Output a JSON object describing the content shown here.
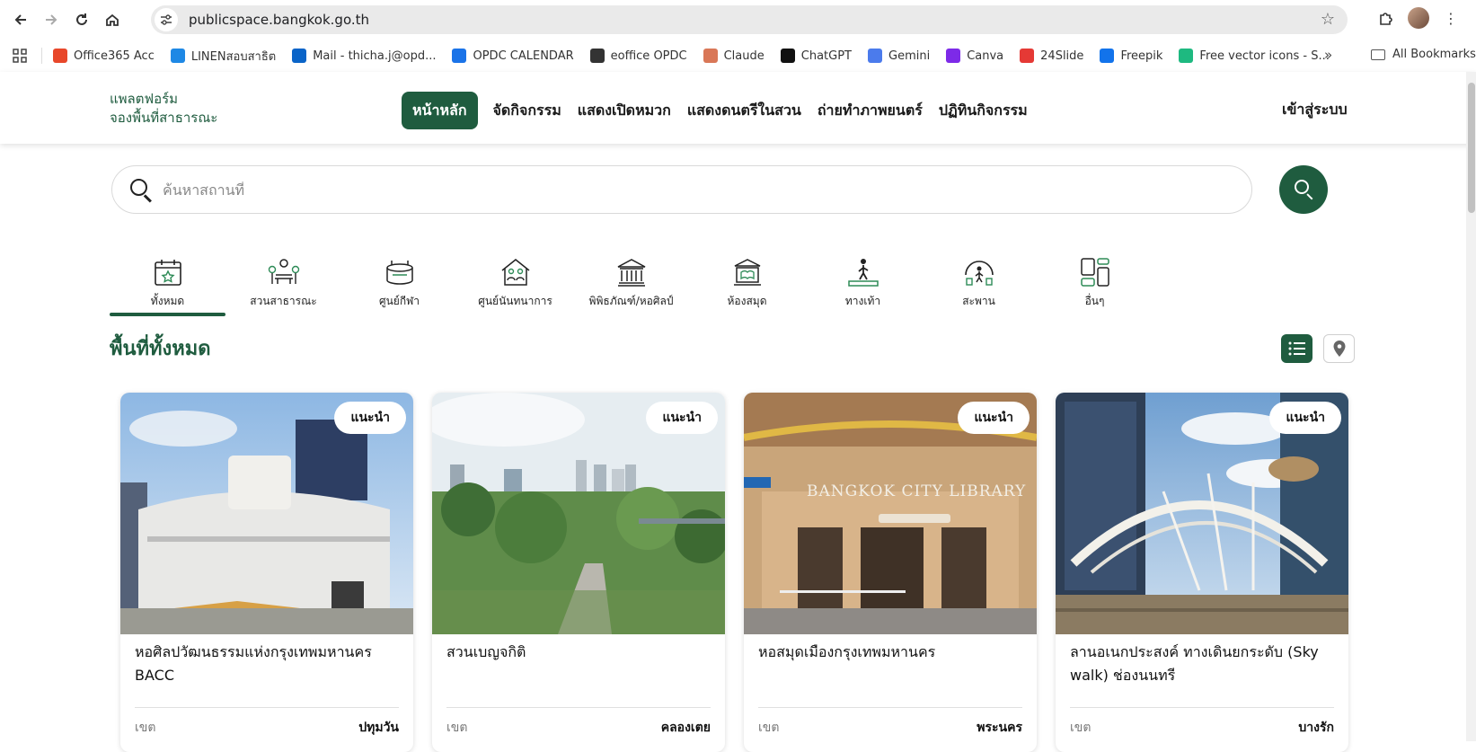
{
  "browser": {
    "url": "publicspace.bangkok.go.th",
    "bookmarks": [
      {
        "label": "Office365 Acc",
        "color": "#e8472a"
      },
      {
        "label": "LINENสอบสาธิต",
        "color": "#1e88e5"
      },
      {
        "label": "Mail - thicha.j@opd...",
        "color": "#0a64c8"
      },
      {
        "label": "OPDC CALENDAR",
        "color": "#1a73e8"
      },
      {
        "label": "eoffice OPDC",
        "color": "#333333"
      },
      {
        "label": "Claude",
        "color": "#d97757"
      },
      {
        "label": "ChatGPT",
        "color": "#111111"
      },
      {
        "label": "Gemini",
        "color": "#4b7bec"
      },
      {
        "label": "Canva",
        "color": "#7d2ae8"
      },
      {
        "label": "24Slide",
        "color": "#e53935"
      },
      {
        "label": "Freepik",
        "color": "#1273eb"
      },
      {
        "label": "Free vector icons - S...",
        "color": "#1eb980"
      }
    ],
    "more_label": "»",
    "all_bookmarks_label": "All Bookmarks"
  },
  "header": {
    "brand_line1": "แพลตฟอร์ม",
    "brand_line2": "จองพื้นที่สาธารณะ",
    "nav": [
      "หน้าหลัก",
      "จัดกิจกรรม",
      "แสดงเปิดหมวก",
      "แสดงดนตรีในสวน",
      "ถ่ายทำภาพยนตร์",
      "ปฏิทินกิจกรรม"
    ],
    "login_label": "เข้าสู่ระบบ"
  },
  "search": {
    "placeholder": "ค้นหาสถานที่"
  },
  "categories": [
    {
      "label": "ทั้งหมด",
      "icon": "calendar-star-icon"
    },
    {
      "label": "สวนสาธารณะ",
      "icon": "park-bench-icon"
    },
    {
      "label": "ศูนย์กีฬา",
      "icon": "stadium-icon"
    },
    {
      "label": "ศูนย์นันทนาการ",
      "icon": "recreation-house-icon"
    },
    {
      "label": "พิพิธภัณฑ์/หอศิลป์",
      "icon": "museum-icon"
    },
    {
      "label": "ห้องสมุด",
      "icon": "library-icon"
    },
    {
      "label": "ทางเท้า",
      "icon": "pedestrian-icon"
    },
    {
      "label": "สะพาน",
      "icon": "bridge-icon"
    },
    {
      "label": "อื่นๆ",
      "icon": "other-grid-icon"
    }
  ],
  "section_title": "พื้นที่ทั้งหมด",
  "accent_color": "#1f5c3f",
  "cards": [
    {
      "badge": "แนะนำ",
      "title": "หอศิลปวัฒนธรรมแห่งกรุงเทพมหานคร BACC",
      "district_label": "เขต",
      "district": "ปทุมวัน"
    },
    {
      "badge": "แนะนำ",
      "title": "สวนเบญจกิติ",
      "district_label": "เขต",
      "district": "คลองเตย"
    },
    {
      "badge": "แนะนำ",
      "title": "หอสมุดเมืองกรุงเทพมหานคร",
      "district_label": "เขต",
      "district": "พระนคร",
      "sign_text": "BANGKOK CITY LIBRARY"
    },
    {
      "badge": "แนะนำ",
      "title": "ลานอเนกประสงค์ ทางเดินยกระดับ (Sky walk) ช่องนนทรี",
      "district_label": "เขต",
      "district": "บางรัก"
    }
  ]
}
